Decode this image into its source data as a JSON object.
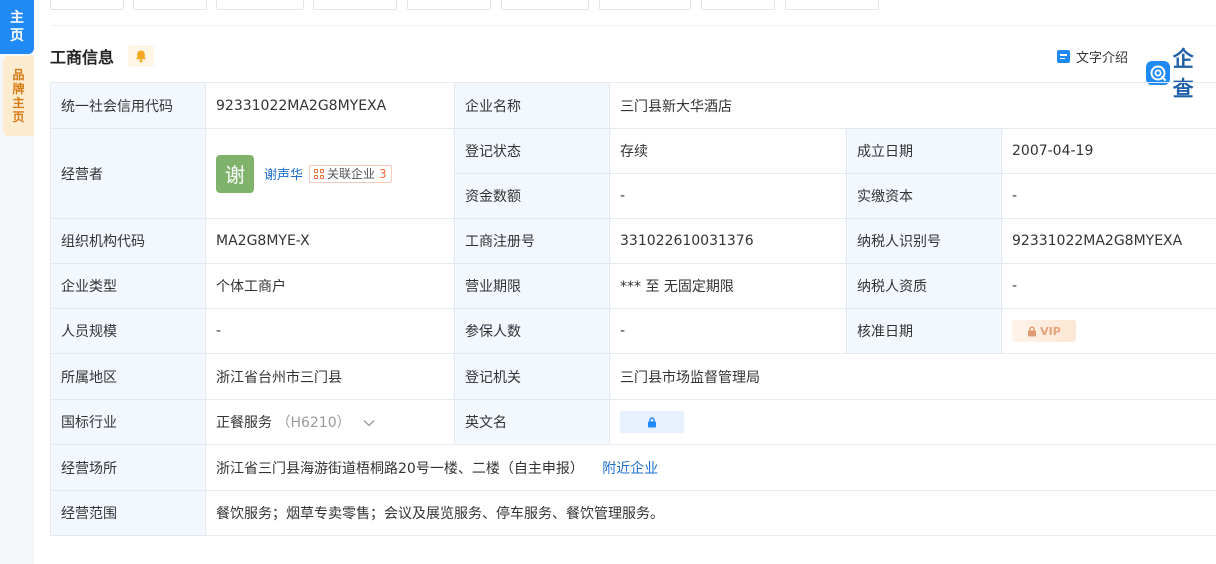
{
  "side_tabs": {
    "main_label": "主页",
    "brand_label": "品牌主页"
  },
  "section": {
    "title": "工商信息",
    "intro_label": "文字介绍",
    "logo_text": "企查"
  },
  "icons": {
    "bell": "bell-icon",
    "doc": "document-icon",
    "logo": "qichacha-logo-icon",
    "lock": "lock-icon",
    "chevron": "chevron-down-icon",
    "relation": "relation-icon"
  },
  "colors": {
    "accent": "#1f8af5",
    "label_bg": "#f2f8fe",
    "link": "#1f6fcf",
    "badge_count": "#ee6b3b",
    "brand_tab": "#fdebcf"
  },
  "table": {
    "credit_code_label": "统一社会信用代码",
    "credit_code": "92331022MA2G8MYEXA",
    "company_name_label": "企业名称",
    "company_name": "三门县新大华酒店",
    "operator_label": "经营者",
    "operator_avatar": "谢",
    "operator_name": "谢声华",
    "related_label": "关联企业",
    "related_count": "3",
    "reg_status_label": "登记状态",
    "reg_status": "存续",
    "founded_label": "成立日期",
    "founded": "2007-04-19",
    "capital_label": "资金数额",
    "capital": "-",
    "paid_capital_label": "实缴资本",
    "paid_capital": "-",
    "org_code_label": "组织机构代码",
    "org_code": "MA2G8MYE-X",
    "reg_no_label": "工商注册号",
    "reg_no": "331022610031376",
    "taxpayer_id_label": "纳税人识别号",
    "taxpayer_id": "92331022MA2G8MYEXA",
    "type_label": "企业类型",
    "type": "个体工商户",
    "term_label": "营业期限",
    "term": "*** 至 无固定期限",
    "taxpayer_qual_label": "纳税人资质",
    "taxpayer_qual": "-",
    "staff_label": "人员规模",
    "staff": "-",
    "insured_label": "参保人数",
    "insured": "-",
    "approval_label": "核准日期",
    "approval_vip": "VIP",
    "region_label": "所属地区",
    "region": "浙江省台州市三门县",
    "authority_label": "登记机关",
    "authority": "三门县市场监督管理局",
    "industry_label": "国标行业",
    "industry": "正餐服务",
    "industry_code": "（H6210）",
    "english_label": "英文名",
    "address_label": "经营场所",
    "address": "浙江省三门县海游街道梧桐路20号一楼、二楼（自主申报）",
    "nearby_label": "附近企业",
    "scope_label": "经营范围",
    "scope": "餐饮服务；烟草专卖零售；会议及展览服务、停车服务、餐饮管理服务。"
  }
}
